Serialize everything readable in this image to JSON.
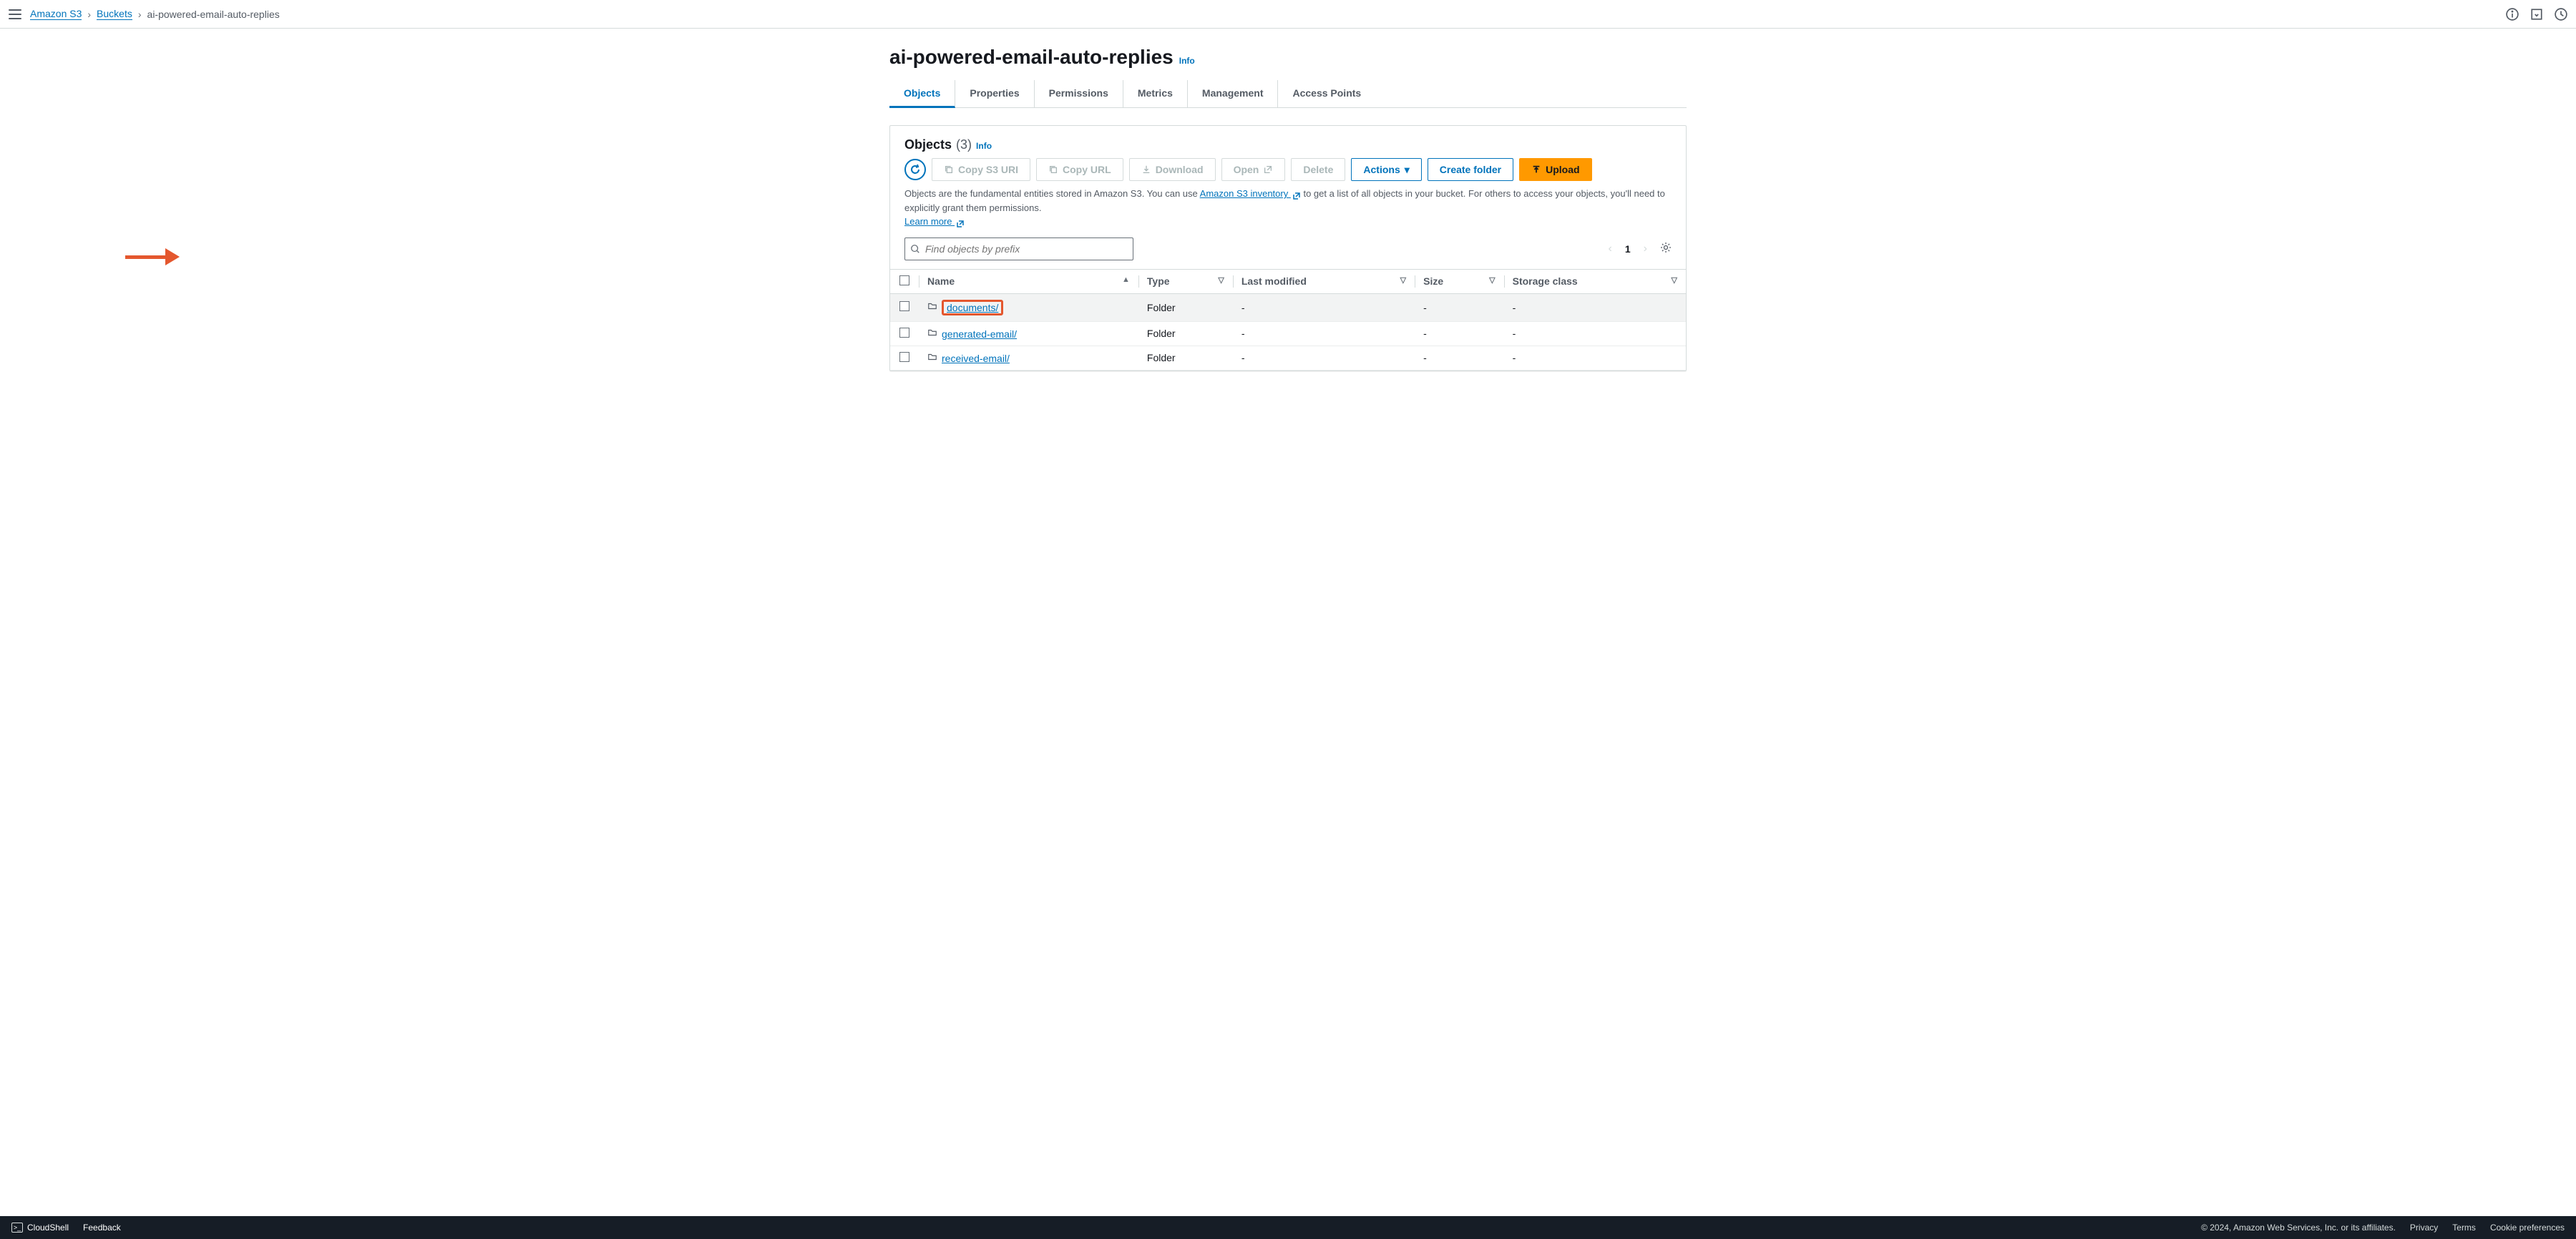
{
  "breadcrumbs": {
    "root": "Amazon S3",
    "buckets": "Buckets",
    "current": "ai-powered-email-auto-replies"
  },
  "page": {
    "title": "ai-powered-email-auto-replies",
    "info": "Info"
  },
  "tabs": {
    "objects": "Objects",
    "properties": "Properties",
    "permissions": "Permissions",
    "metrics": "Metrics",
    "management": "Management",
    "access_points": "Access Points"
  },
  "objects_panel": {
    "title": "Objects",
    "count": "(3)",
    "info": "Info",
    "desc_prefix": "Objects are the fundamental entities stored in Amazon S3. You can use ",
    "inventory_link": "Amazon S3 inventory ",
    "desc_suffix": " to get a list of all objects in your bucket. For others to access your objects, you'll need to explicitly grant them permissions. ",
    "learn_more": "Learn more ",
    "search_placeholder": "Find objects by prefix",
    "page": "1"
  },
  "buttons": {
    "copy_s3_uri": "Copy S3 URI",
    "copy_url": "Copy URL",
    "download": "Download",
    "open": "Open",
    "delete": "Delete",
    "actions": "Actions",
    "create_folder": "Create folder",
    "upload": "Upload"
  },
  "columns": {
    "name": "Name",
    "type": "Type",
    "last_modified": "Last modified",
    "size": "Size",
    "storage_class": "Storage class"
  },
  "rows": [
    {
      "name": "documents/",
      "type": "Folder",
      "last_modified": "-",
      "size": "-",
      "storage_class": "-"
    },
    {
      "name": "generated-email/",
      "type": "Folder",
      "last_modified": "-",
      "size": "-",
      "storage_class": "-"
    },
    {
      "name": "received-email/",
      "type": "Folder",
      "last_modified": "-",
      "size": "-",
      "storage_class": "-"
    }
  ],
  "footer": {
    "cloudshell": "CloudShell",
    "feedback": "Feedback",
    "copyright": "© 2024, Amazon Web Services, Inc. or its affiliates.",
    "privacy": "Privacy",
    "terms": "Terms",
    "cookies": "Cookie preferences"
  }
}
